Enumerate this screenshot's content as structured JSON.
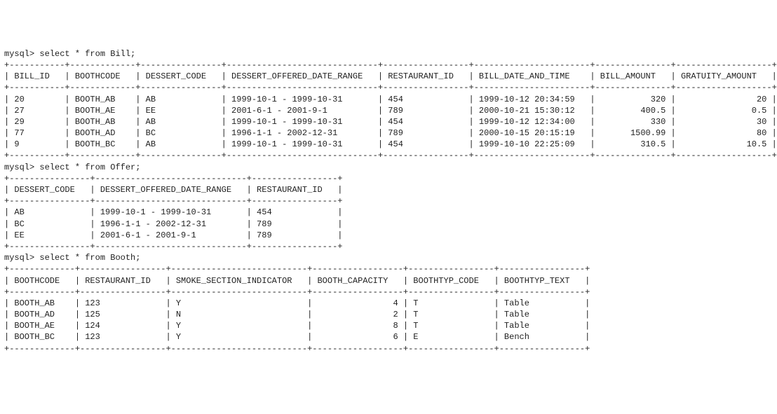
{
  "queries": [
    {
      "prompt": "mysql> ",
      "sql": "select * from Bill;",
      "columns": [
        "BILL_ID",
        "BOOTHCODE",
        "DESSERT_CODE",
        "DESSERT_OFFERED_DATE_RANGE",
        "RESTAURANT_ID",
        "BILL_DATE_AND_TIME",
        "BILL_AMOUNT",
        "GRATUITY_AMOUNT"
      ],
      "widths": [
        9,
        11,
        14,
        28,
        15,
        21,
        13,
        17
      ],
      "align": [
        "L",
        "L",
        "L",
        "L",
        "L",
        "L",
        "R",
        "R"
      ],
      "rows": [
        [
          "20",
          "BOOTH_AB",
          "AB",
          "1999-10-1 - 1999-10-31",
          "454",
          "1999-10-12 20:34:59",
          "320",
          "20"
        ],
        [
          "27",
          "BOOTH_AE",
          "EE",
          "2001-6-1 - 2001-9-1",
          "789",
          "2000-10-21 15:30:12",
          "400.5",
          "0.5"
        ],
        [
          "29",
          "BOOTH_AB",
          "AB",
          "1999-10-1 - 1999-10-31",
          "454",
          "1999-10-12 12:34:00",
          "330",
          "30"
        ],
        [
          "77",
          "BOOTH_AD",
          "BC",
          "1996-1-1 - 2002-12-31",
          "789",
          "2000-10-15 20:15:19",
          "1500.99",
          "80"
        ],
        [
          "9",
          "BOOTH_BC",
          "AB",
          "1999-10-1 - 1999-10-31",
          "454",
          "1999-10-10 22:25:09",
          "310.5",
          "10.5"
        ]
      ]
    },
    {
      "prompt": "mysql> ",
      "sql": "select * from Offer;",
      "columns": [
        "DESSERT_CODE",
        "DESSERT_OFFERED_DATE_RANGE",
        "RESTAURANT_ID"
      ],
      "widths": [
        14,
        28,
        15
      ],
      "align": [
        "L",
        "L",
        "L"
      ],
      "rows": [
        [
          "AB",
          "1999-10-1 - 1999-10-31",
          "454"
        ],
        [
          "BC",
          "1996-1-1 - 2002-12-31",
          "789"
        ],
        [
          "EE",
          "2001-6-1 - 2001-9-1",
          "789"
        ]
      ]
    },
    {
      "prompt": "mysql> ",
      "sql": "select * from Booth;",
      "columns": [
        "BOOTHCODE",
        "RESTAURANT_ID",
        "SMOKE_SECTION_INDICATOR",
        "BOOTH_CAPACITY",
        "BOOTHTYP_CODE",
        "BOOTHTYP_TEXT"
      ],
      "widths": [
        11,
        15,
        25,
        16,
        15,
        15
      ],
      "align": [
        "L",
        "L",
        "L",
        "R",
        "L",
        "L"
      ],
      "rows": [
        [
          "BOOTH_AB",
          "123",
          "Y",
          "4",
          "T",
          "Table"
        ],
        [
          "BOOTH_AD",
          "125",
          "N",
          "2",
          "T",
          "Table"
        ],
        [
          "BOOTH_AE",
          "124",
          "Y",
          "8",
          "T",
          "Table"
        ],
        [
          "BOOTH_BC",
          "123",
          "Y",
          "6",
          "E",
          "Bench"
        ]
      ]
    }
  ],
  "chart_data": [
    {
      "type": "table",
      "title": "Bill",
      "columns": [
        "BILL_ID",
        "BOOTHCODE",
        "DESSERT_CODE",
        "DESSERT_OFFERED_DATE_RANGE",
        "RESTAURANT_ID",
        "BILL_DATE_AND_TIME",
        "BILL_AMOUNT",
        "GRATUITY_AMOUNT"
      ],
      "rows": [
        [
          20,
          "BOOTH_AB",
          "AB",
          "1999-10-1 - 1999-10-31",
          454,
          "1999-10-12 20:34:59",
          320,
          20
        ],
        [
          27,
          "BOOTH_AE",
          "EE",
          "2001-6-1 - 2001-9-1",
          789,
          "2000-10-21 15:30:12",
          400.5,
          0.5
        ],
        [
          29,
          "BOOTH_AB",
          "AB",
          "1999-10-1 - 1999-10-31",
          454,
          "1999-10-12 12:34:00",
          330,
          30
        ],
        [
          77,
          "BOOTH_AD",
          "BC",
          "1996-1-1 - 2002-12-31",
          789,
          "2000-10-15 20:15:19",
          1500.99,
          80
        ],
        [
          9,
          "BOOTH_BC",
          "AB",
          "1999-10-1 - 1999-10-31",
          454,
          "1999-10-10 22:25:09",
          310.5,
          10.5
        ]
      ]
    },
    {
      "type": "table",
      "title": "Offer",
      "columns": [
        "DESSERT_CODE",
        "DESSERT_OFFERED_DATE_RANGE",
        "RESTAURANT_ID"
      ],
      "rows": [
        [
          "AB",
          "1999-10-1 - 1999-10-31",
          454
        ],
        [
          "BC",
          "1996-1-1 - 2002-12-31",
          789
        ],
        [
          "EE",
          "2001-6-1 - 2001-9-1",
          789
        ]
      ]
    },
    {
      "type": "table",
      "title": "Booth",
      "columns": [
        "BOOTHCODE",
        "RESTAURANT_ID",
        "SMOKE_SECTION_INDICATOR",
        "BOOTH_CAPACITY",
        "BOOTHTYP_CODE",
        "BOOTHTYP_TEXT"
      ],
      "rows": [
        [
          "BOOTH_AB",
          123,
          "Y",
          4,
          "T",
          "Table"
        ],
        [
          "BOOTH_AD",
          125,
          "N",
          2,
          "T",
          "Table"
        ],
        [
          "BOOTH_AE",
          124,
          "Y",
          8,
          "T",
          "Table"
        ],
        [
          "BOOTH_BC",
          123,
          "Y",
          6,
          "E",
          "Bench"
        ]
      ]
    }
  ]
}
